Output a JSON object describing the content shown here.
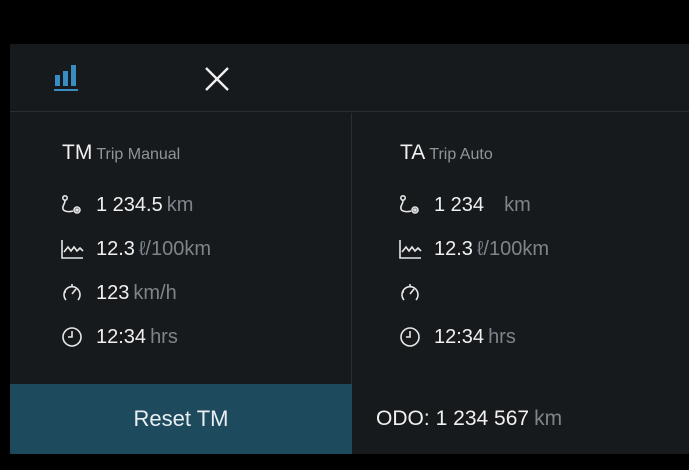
{
  "colors": {
    "accent": "#3a8dc2",
    "reset_bg": "#1e4a5e",
    "panel_bg": "#171a1c"
  },
  "toolbar": {
    "stats_icon": "bar-chart-icon",
    "close_icon": "close-icon"
  },
  "trip_manual": {
    "code": "TM",
    "name": "Trip Manual",
    "distance": {
      "value": "1 234.5",
      "unit": "km",
      "icon": "route-icon"
    },
    "consumption": {
      "value": "12.3",
      "unit": "ℓ/100km",
      "icon": "consumption-graph-icon"
    },
    "avg_speed": {
      "value": "123",
      "unit": "km/h",
      "icon": "speed-gauge-icon"
    },
    "time": {
      "value": "12:34",
      "unit": "hrs",
      "icon": "clock-icon"
    }
  },
  "trip_auto": {
    "code": "TA",
    "name": "Trip Auto",
    "distance": {
      "value": "1 234",
      "unit": "km",
      "icon": "route-icon"
    },
    "consumption": {
      "value": "12.3",
      "unit": "ℓ/100km",
      "icon": "consumption-graph-icon"
    },
    "avg_speed": {
      "value": "",
      "unit": "",
      "icon": "speed-gauge-icon"
    },
    "time": {
      "value": "12:34",
      "unit": "hrs",
      "icon": "clock-icon"
    }
  },
  "reset_button": {
    "label": "Reset TM"
  },
  "odometer": {
    "label": "ODO:",
    "value": "1 234 567",
    "unit": "km"
  }
}
